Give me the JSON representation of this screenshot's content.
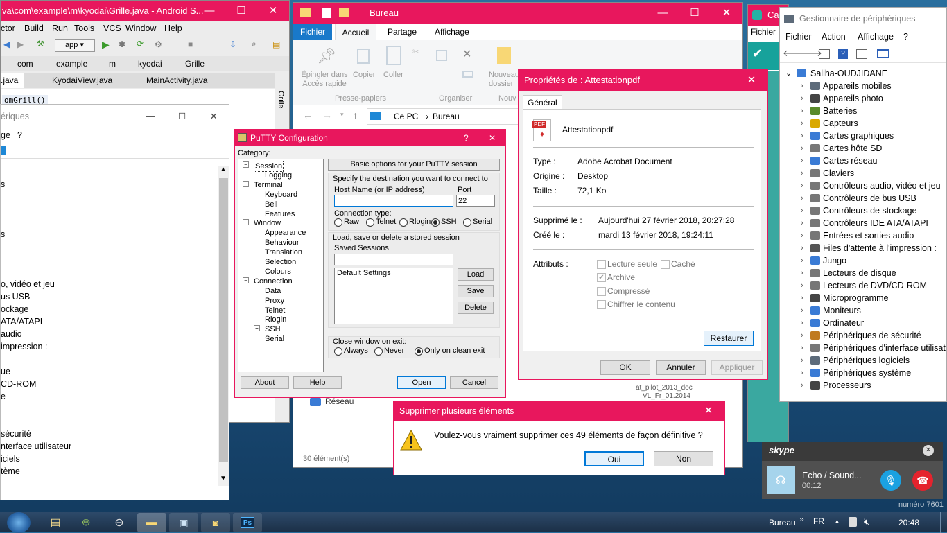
{
  "android_studio": {
    "title": "va\\com\\example\\m\\kyodai\\Grille.java - Android S...",
    "menu": [
      "ctor",
      "Build",
      "Run",
      "Tools",
      "VCS",
      "Window",
      "Help"
    ],
    "app_selector": "app",
    "breadcrumbs": [
      "com",
      "example",
      "m",
      "kyodai",
      "Grille"
    ],
    "tabs": [
      ".java",
      "KyodaiView.java",
      "MainActivity.java"
    ],
    "method_hint": "omGrill()",
    "side_tab": "Grille"
  },
  "left_device_window": {
    "title": "ériques",
    "menu": [
      "ge",
      "?"
    ],
    "items": [
      "s",
      "s",
      "o, vidéo et jeu",
      "us USB",
      "ockage",
      "ATA/ATAPI",
      "audio",
      "impression :",
      "ue",
      "CD-ROM",
      "e",
      "sécurité",
      "nterface utilisateur",
      "iciels",
      "tème"
    ]
  },
  "explorer": {
    "title": "Bureau",
    "ribbon_tabs": [
      "Fichier",
      "Accueil",
      "Partage",
      "Affichage"
    ],
    "pin_label": "Épingler dans Accès rapide",
    "copy": "Copier",
    "paste": "Coller",
    "new_folder": "Nouveau dossier",
    "group_clipboard": "Presse-papiers",
    "group_organize": "Organiser",
    "group_new": "Nouv",
    "path": [
      "Ce PC",
      "Bureau"
    ],
    "network": "Réseau",
    "status": "30 élément(s)",
    "file_caption_1": "at_pilot_2013_doc",
    "file_caption_2": "VL_Fr_01.2014"
  },
  "putty": {
    "title": "PuTTY Configuration",
    "help": "?",
    "category_label": "Category:",
    "tree": [
      {
        "label": "Session",
        "level": 0,
        "expander": "−"
      },
      {
        "label": "Logging",
        "level": 1
      },
      {
        "label": "Terminal",
        "level": 0,
        "expander": "−"
      },
      {
        "label": "Keyboard",
        "level": 1
      },
      {
        "label": "Bell",
        "level": 1
      },
      {
        "label": "Features",
        "level": 1
      },
      {
        "label": "Window",
        "level": 0,
        "expander": "−"
      },
      {
        "label": "Appearance",
        "level": 1
      },
      {
        "label": "Behaviour",
        "level": 1
      },
      {
        "label": "Translation",
        "level": 1
      },
      {
        "label": "Selection",
        "level": 1
      },
      {
        "label": "Colours",
        "level": 1
      },
      {
        "label": "Connection",
        "level": 0,
        "expander": "−"
      },
      {
        "label": "Data",
        "level": 1
      },
      {
        "label": "Proxy",
        "level": 1
      },
      {
        "label": "Telnet",
        "level": 1
      },
      {
        "label": "Rlogin",
        "level": 1
      },
      {
        "label": "SSH",
        "level": 1,
        "expander": "+"
      },
      {
        "label": "Serial",
        "level": 1
      }
    ],
    "header": "Basic options for your PuTTY session",
    "dest_label": "Specify the destination you want to connect to",
    "host_label": "Host Name (or IP address)",
    "host_value": "",
    "port_label": "Port",
    "port_value": "22",
    "conn_type_label": "Connection type:",
    "conn_types": [
      "Raw",
      "Telnet",
      "Rlogin",
      "SSH",
      "Serial"
    ],
    "conn_selected": "SSH",
    "load_save_label": "Load, save or delete a stored session",
    "saved_label": "Saved Sessions",
    "saved_value": "",
    "sessions": [
      "Default Settings"
    ],
    "load": "Load",
    "save": "Save",
    "delete": "Delete",
    "close_label": "Close window on exit:",
    "close_options": [
      "Always",
      "Never",
      "Only on clean exit"
    ],
    "close_selected": "Only on clean exit",
    "about": "About",
    "helpbtn": "Help",
    "open": "Open",
    "cancel": "Cancel"
  },
  "props": {
    "title": "Propriétés de : Attestationpdf",
    "tab": "Général",
    "filename": "Attestationpdf",
    "icon_text": "PDF",
    "type_label": "Type :",
    "type_value": "Adobe Acrobat Document",
    "origin_label": "Origine :",
    "origin_value": "Desktop",
    "size_label": "Taille :",
    "size_value": "72,1 Ko",
    "deleted_label": "Supprimé le :",
    "deleted_value": "Aujourd'hui 27 février 2018, 20:27:28",
    "created_label": "Créé le :",
    "created_value": "mardi 13 février 2018, 19:24:11",
    "attr_label": "Attributs :",
    "readonly": "Lecture seule",
    "hidden": "Caché",
    "archive": "Archive",
    "compressed": "Compressé",
    "encrypt": "Chiffrer le contenu",
    "restore": "Restaurer",
    "ok": "OK",
    "cancel": "Annuler",
    "apply": "Appliquer"
  },
  "device_manager": {
    "title": "Gestionnaire de périphériques",
    "menu": [
      "Fichier",
      "Action",
      "Affichage",
      "?"
    ],
    "root": "Saliha-OUDJIDANE",
    "items": [
      "Appareils mobiles",
      "Appareils photo",
      "Batteries",
      "Capteurs",
      "Cartes graphiques",
      "Cartes hôte SD",
      "Cartes réseau",
      "Claviers",
      "Contrôleurs audio, vidéo et jeu",
      "Contrôleurs de bus USB",
      "Contrôleurs de stockage",
      "Contrôleurs IDE ATA/ATAPI",
      "Entrées et sorties audio",
      "Files d'attente à l'impression :",
      "Jungo",
      "Lecteurs de disque",
      "Lecteurs de DVD/CD-ROM",
      "Microprogramme",
      "Moniteurs",
      "Ordinateur",
      "Périphériques de sécurité",
      "Périphériques d'interface utilisateur",
      "Périphériques logiciels",
      "Périphériques système",
      "Processeurs"
    ]
  },
  "back_window": {
    "title": "Ca",
    "menu": "Fichier"
  },
  "confirm": {
    "title": "Supprimer plusieurs éléments",
    "message": "Voulez-vous vraiment supprimer ces 49 éléments de façon définitive ?",
    "yes": "Oui",
    "no": "Non"
  },
  "skype": {
    "brand": "skype",
    "name": "Echo / Sound...",
    "duration": "00:12",
    "bg_text": "numéro 7601"
  },
  "taskbar": {
    "toolbar_label": "Bureau",
    "chevron": "»",
    "lang": "FR",
    "time": "20:48",
    "ps_label": "Ps"
  },
  "colors": {
    "accent": "#e8175d",
    "select_blue": "#0078d7",
    "explorer_ribbon": "#1979ca",
    "skype_mic": "#1aa1e1",
    "skype_hangup": "#e5232d"
  }
}
